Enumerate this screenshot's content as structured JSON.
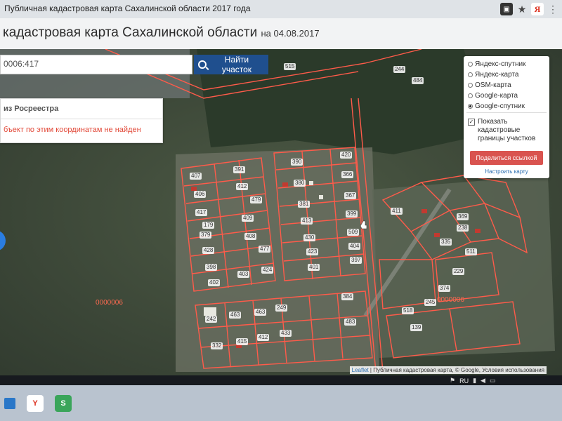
{
  "browser": {
    "tab_title": "Публичная кадастровая карта Сахалинской области 2017 года"
  },
  "header": {
    "title": "кадастровая карта Сахалинской области",
    "date": "на 04.08.2017"
  },
  "search": {
    "value": "0006:417",
    "button_label": "Найти участок"
  },
  "results": {
    "source_label": "из Росреестра",
    "message": "бъект по этим координатам не найден"
  },
  "layers": {
    "options": [
      "Яндекс-спутник",
      "Яндекс-карта",
      "OSM-карта",
      "Google-карта",
      "Google-спутник"
    ],
    "selected": "Google-спутник",
    "show_borders_label": "Показать кадастровые границы участков",
    "share_button": "Поделиться ссылкой",
    "setup_link": "Настроить карту"
  },
  "map": {
    "attribution_leaflet": "Leaflet",
    "attribution_rest": "| Публичная кадастровая карта, © Google, Условия использования",
    "quarter_labels": [
      "0000006",
      "0000006"
    ],
    "plot_labels": [
      "515",
      "244",
      "484",
      "391",
      "390",
      "420",
      "407",
      "412",
      "380",
      "366",
      "406",
      "479",
      "381",
      "367",
      "417",
      "409",
      "413",
      "399",
      "411",
      "179",
      "379",
      "408",
      "430",
      "509",
      "428",
      "477",
      "423",
      "404",
      "398",
      "403",
      "424",
      "401",
      "397",
      "402",
      "384",
      "242",
      "463",
      "249",
      "463",
      "483",
      "412",
      "433",
      "518",
      "139",
      "332",
      "415",
      "369",
      "238",
      "335",
      "229",
      "374",
      "245",
      "511"
    ]
  },
  "taskbar": {
    "lang": "RU"
  },
  "colors": {
    "cadastral_line": "#ff5b4a",
    "share_button": "#d9534f",
    "search_button": "#1f4f8e"
  }
}
